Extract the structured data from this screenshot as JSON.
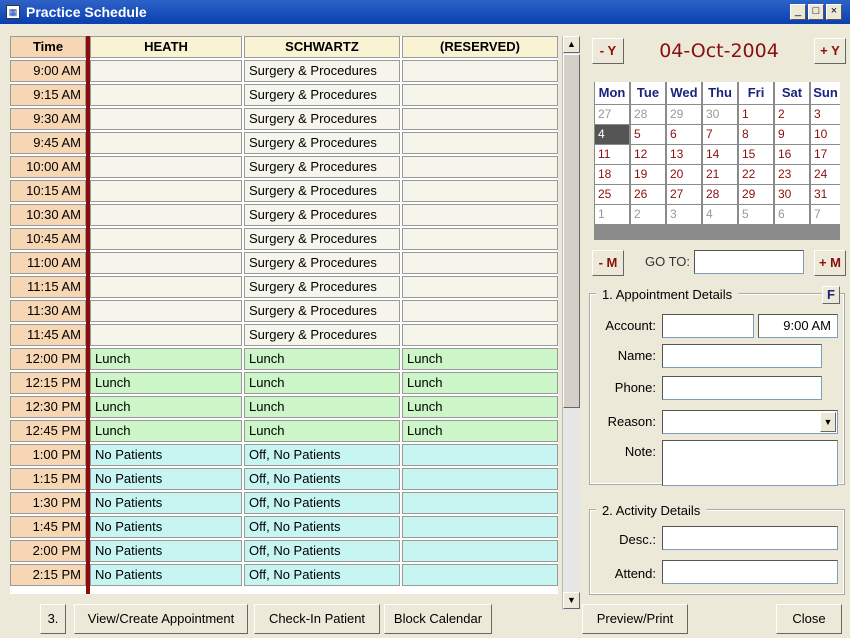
{
  "window": {
    "title": "Practice Schedule",
    "icon": "form-icon",
    "controls": {
      "minimize": "_",
      "maximize": "□",
      "close": "×"
    }
  },
  "grid": {
    "headers": [
      "Time",
      "HEATH",
      "SCHWARTZ",
      "(RESERVED)"
    ],
    "rows": [
      {
        "time": "9:00 AM",
        "heath": "",
        "schwartz": "Surgery & Procedures",
        "reserved": "",
        "kind": "normal"
      },
      {
        "time": "9:15 AM",
        "heath": "",
        "schwartz": "Surgery & Procedures",
        "reserved": "",
        "kind": "normal"
      },
      {
        "time": "9:30 AM",
        "heath": "",
        "schwartz": "Surgery & Procedures",
        "reserved": "",
        "kind": "normal"
      },
      {
        "time": "9:45 AM",
        "heath": "",
        "schwartz": "Surgery & Procedures",
        "reserved": "",
        "kind": "normal"
      },
      {
        "time": "10:00 AM",
        "heath": "",
        "schwartz": "Surgery & Procedures",
        "reserved": "",
        "kind": "normal"
      },
      {
        "time": "10:15 AM",
        "heath": "",
        "schwartz": "Surgery & Procedures",
        "reserved": "",
        "kind": "normal"
      },
      {
        "time": "10:30 AM",
        "heath": "",
        "schwartz": "Surgery & Procedures",
        "reserved": "",
        "kind": "normal"
      },
      {
        "time": "10:45 AM",
        "heath": "",
        "schwartz": "Surgery & Procedures",
        "reserved": "",
        "kind": "normal"
      },
      {
        "time": "11:00 AM",
        "heath": "",
        "schwartz": "Surgery & Procedures",
        "reserved": "",
        "kind": "normal"
      },
      {
        "time": "11:15 AM",
        "heath": "",
        "schwartz": "Surgery & Procedures",
        "reserved": "",
        "kind": "normal"
      },
      {
        "time": "11:30 AM",
        "heath": "",
        "schwartz": "Surgery & Procedures",
        "reserved": "",
        "kind": "normal"
      },
      {
        "time": "11:45 AM",
        "heath": "",
        "schwartz": "Surgery & Procedures",
        "reserved": "",
        "kind": "normal"
      },
      {
        "time": "12:00 PM",
        "heath": "Lunch",
        "schwartz": "Lunch",
        "reserved": "Lunch",
        "kind": "lunch"
      },
      {
        "time": "12:15 PM",
        "heath": "Lunch",
        "schwartz": "Lunch",
        "reserved": "Lunch",
        "kind": "lunch"
      },
      {
        "time": "12:30 PM",
        "heath": "Lunch",
        "schwartz": "Lunch",
        "reserved": "Lunch",
        "kind": "lunch"
      },
      {
        "time": "12:45 PM",
        "heath": "Lunch",
        "schwartz": "Lunch",
        "reserved": "Lunch",
        "kind": "lunch"
      },
      {
        "time": "1:00 PM",
        "heath": "No Patients",
        "schwartz": "Off, No Patients",
        "reserved": "",
        "kind": "off"
      },
      {
        "time": "1:15 PM",
        "heath": "No Patients",
        "schwartz": "Off, No Patients",
        "reserved": "",
        "kind": "off"
      },
      {
        "time": "1:30 PM",
        "heath": "No Patients",
        "schwartz": "Off, No Patients",
        "reserved": "",
        "kind": "off"
      },
      {
        "time": "1:45 PM",
        "heath": "No Patients",
        "schwartz": "Off, No Patients",
        "reserved": "",
        "kind": "off"
      },
      {
        "time": "2:00 PM",
        "heath": "No Patients",
        "schwartz": "Off, No Patients",
        "reserved": "",
        "kind": "off"
      },
      {
        "time": "2:15 PM",
        "heath": "No Patients",
        "schwartz": "Off, No Patients",
        "reserved": "",
        "kind": "off"
      }
    ],
    "colors": {
      "normal": "#f5f5ec",
      "lunch": "#ccf5c8",
      "off": "#c6f5f2"
    }
  },
  "calendar": {
    "prev_year": "- Y",
    "next_year": "+ Y",
    "date": "04-Oct-2004",
    "days": [
      "Mon",
      "Tue",
      "Wed",
      "Thu",
      "Fri",
      "Sat",
      "Sun"
    ],
    "weeks": [
      [
        [
          "27",
          "o"
        ],
        [
          "28",
          "o"
        ],
        [
          "29",
          "o"
        ],
        [
          "30",
          "o"
        ],
        [
          "1",
          ""
        ],
        [
          "2",
          ""
        ],
        [
          "3",
          ""
        ]
      ],
      [
        [
          "4",
          "s"
        ],
        [
          "5",
          ""
        ],
        [
          "6",
          ""
        ],
        [
          "7",
          ""
        ],
        [
          "8",
          ""
        ],
        [
          "9",
          ""
        ],
        [
          "10",
          ""
        ]
      ],
      [
        [
          "11",
          ""
        ],
        [
          "12",
          ""
        ],
        [
          "13",
          ""
        ],
        [
          "14",
          ""
        ],
        [
          "15",
          ""
        ],
        [
          "16",
          ""
        ],
        [
          "17",
          ""
        ]
      ],
      [
        [
          "18",
          ""
        ],
        [
          "19",
          ""
        ],
        [
          "20",
          ""
        ],
        [
          "21",
          ""
        ],
        [
          "22",
          ""
        ],
        [
          "23",
          ""
        ],
        [
          "24",
          ""
        ]
      ],
      [
        [
          "25",
          ""
        ],
        [
          "26",
          ""
        ],
        [
          "27",
          ""
        ],
        [
          "28",
          ""
        ],
        [
          "29",
          ""
        ],
        [
          "30",
          ""
        ],
        [
          "31",
          ""
        ]
      ],
      [
        [
          "1",
          "o"
        ],
        [
          "2",
          "o"
        ],
        [
          "3",
          "o"
        ],
        [
          "4",
          "o"
        ],
        [
          "5",
          "o"
        ],
        [
          "6",
          "o"
        ],
        [
          "7",
          "o"
        ]
      ]
    ],
    "prev_month": "- M",
    "next_month": "+ M",
    "goto_label": "GO TO:",
    "goto_value": ""
  },
  "appointment": {
    "legend": "1. Appointment Details",
    "f_button": "F",
    "account_label": "Account:",
    "account_value": "",
    "time_value": "9:00 AM",
    "name_label": "Name:",
    "name_value": "",
    "phone_label": "Phone:",
    "phone_value": "",
    "reason_label": "Reason:",
    "reason_value": "",
    "note_label": "Note:",
    "note_value": ""
  },
  "activity": {
    "legend": "2. Activity Details",
    "desc_label": "Desc.:",
    "desc_value": "",
    "attend_label": "Attend:",
    "attend_value": ""
  },
  "bottom": {
    "step": "3.",
    "view_create": "View/Create Appointment",
    "check_in": "Check-In Patient",
    "block_calendar": "Block Calendar",
    "preview_print": "Preview/Print",
    "close": "Close"
  }
}
